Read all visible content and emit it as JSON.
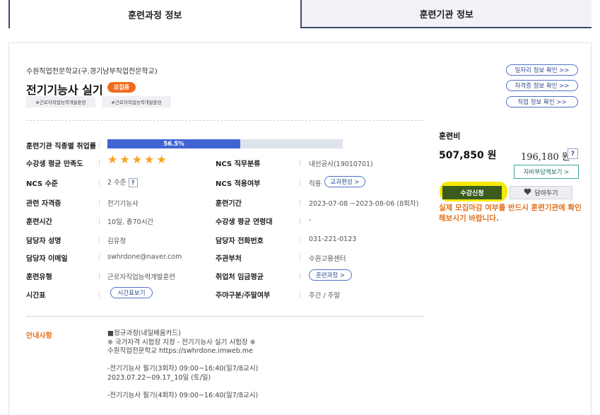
{
  "tabs": [
    "훈련과정 정보",
    "훈련기관 정보"
  ],
  "course": {
    "institution": "수원직업전문학교(구.경기남부직업전문학교)",
    "title": "전기기능사 실기",
    "badge": "모집중",
    "tags": [
      "#근로자직업능력개발훈련",
      "#근로자직업능력개발훈련"
    ]
  },
  "links": [
    "일자리 정보 확인 >>",
    "자격증 정보 확인 >>",
    "직업 정보 확인 >>"
  ],
  "info": {
    "employment_rate_label": "훈련기관 직종별 취업률",
    "employment_rate_text": "56.5%",
    "employment_rate_value": 56.5,
    "satisfaction_label": "수강생 평균 만족도",
    "satisfaction_stars": 5,
    "ncs_category_label": "NCS 직무분류",
    "ncs_category": "내선공사(19010701)",
    "ncs_level_label": "NCS 수준",
    "ncs_level": "2 수준",
    "ncs_apply_label": "NCS 적용여부",
    "ncs_apply": "적용",
    "curriculum_button": "교과편성 >",
    "cert_label": "관련 자격증",
    "cert": "전기기능사",
    "period_label": "훈련기간",
    "period": "2023-07-08 ~2023-08-06 (8회차)",
    "hours_label": "훈련시간",
    "hours": "10일, 총70시간",
    "age_label": "수강생 평균 연령대",
    "age": "-",
    "manager_label": "담당자 성명",
    "manager": "김유정",
    "phone_label": "담당자 전화번호",
    "phone": "031-221-0123",
    "email_label": "담당자 이메일",
    "email": "swhrdone@naver.com",
    "dept_label": "주관부처",
    "dept": "수원고용센터",
    "type_label": "훈련유형",
    "type": "근로자직업능력개발훈련",
    "wage_label": "취업처 임금평균",
    "wage_button": "훈련과정 >",
    "schedule_label": "시간표",
    "schedule_button": "시간표보기",
    "daynight_label": "주야구분/주말여부",
    "daynight": "주간 / 주말",
    "q": "?"
  },
  "fee": {
    "label": "훈련비",
    "total": "507,850 원",
    "self": "196,180 원",
    "q": "?",
    "self_button": "자비부담액보기 >"
  },
  "actions": {
    "apply": "수강신청",
    "favorite": "담아두기",
    "warning": "실제 모집마감 여부를 반드시 훈련기관에 확인해보시기 바랍니다."
  },
  "notice": {
    "label": "안내사항",
    "lines": [
      "■정규과정(내일배움카드)",
      "※ 국가자격 시험장 지정 - 전기기능사 실기 시험장 ※",
      "수원직업전문학교 https://swhrdone.imweb.me",
      "",
      "-전기기능사 필기(3회차) 09:00~16:40(일7/8교시)",
      "2023.07.22~09.17_10일 (토/일)",
      "",
      "-전기기능사 필기(4회차) 09:00~16:40(일7/8교시)"
    ]
  },
  "colors": {
    "accent": "#3f64d4",
    "recruit_badge": "#ef6c1f",
    "warning": "#e0711e",
    "apply": "#3a5d1e",
    "highlight": "#f5e80c",
    "star": "#f4a31e"
  }
}
